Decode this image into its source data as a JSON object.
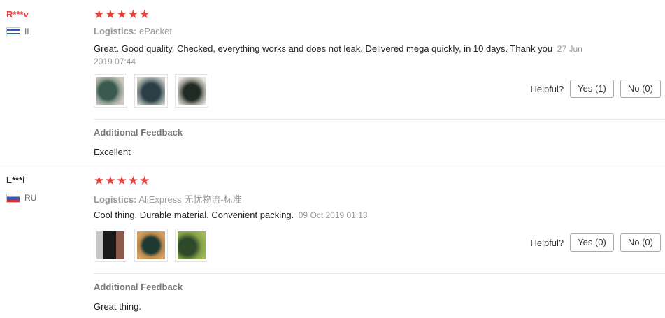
{
  "reviews": [
    {
      "user": "R***v",
      "country": "IL",
      "stars": "★★★★★",
      "rating": 5,
      "logistics_label": "Logistics:",
      "logistics_value": "ePacket",
      "text": "Great. Good quality. Checked, everything works and does not leak. Delivered mega quickly, in 10 days. Thank you",
      "date": "27 Jun 2019 07:44",
      "helpful_label": "Helpful?",
      "yes_label": "Yes (1)",
      "no_label": "No (0)",
      "additional_title": "Additional Feedback",
      "additional_text": "Excellent"
    },
    {
      "user": "L***i",
      "country": "RU",
      "stars": "★★★★★",
      "rating": 5,
      "logistics_label": "Logistics:",
      "logistics_value": "AliExpress 无忧物流-标准",
      "text": "Cool thing. Durable material. Convenient packing.",
      "date": "09 Oct 2019 01:13",
      "helpful_label": "Helpful?",
      "yes_label": "Yes (0)",
      "no_label": "No (0)",
      "additional_title": "Additional Feedback",
      "additional_text": "Great thing."
    }
  ]
}
